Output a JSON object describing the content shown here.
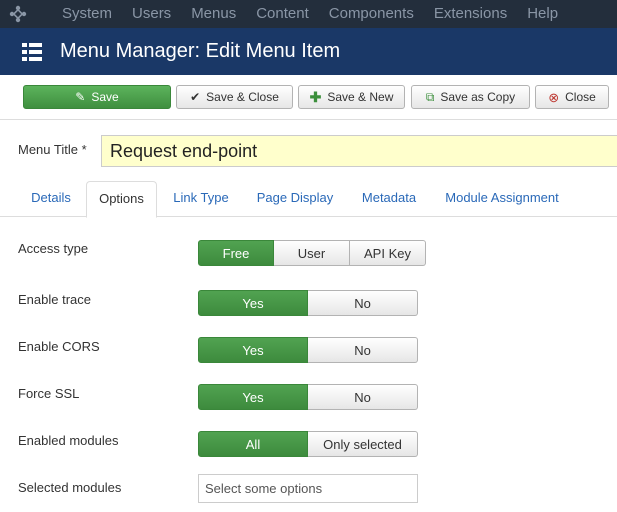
{
  "navbar": {
    "items": [
      "System",
      "Users",
      "Menus",
      "Content",
      "Components",
      "Extensions",
      "Help"
    ]
  },
  "header": {
    "title": "Menu Manager: Edit Menu Item"
  },
  "toolbar": {
    "save": "Save",
    "save_close": "Save & Close",
    "save_new": "Save & New",
    "save_copy": "Save as Copy",
    "close": "Close"
  },
  "menu_title": {
    "label": "Menu Title *",
    "value": "Request end-point"
  },
  "tabs": [
    "Details",
    "Options",
    "Link Type",
    "Page Display",
    "Metadata",
    "Module Assignment"
  ],
  "active_tab": "Options",
  "form": {
    "access_type": {
      "label": "Access type",
      "options": [
        "Free",
        "User",
        "API Key"
      ],
      "selected": "Free"
    },
    "enable_trace": {
      "label": "Enable trace",
      "options": [
        "Yes",
        "No"
      ],
      "selected": "Yes"
    },
    "enable_cors": {
      "label": "Enable CORS",
      "options": [
        "Yes",
        "No"
      ],
      "selected": "Yes"
    },
    "force_ssl": {
      "label": "Force SSL",
      "options": [
        "Yes",
        "No"
      ],
      "selected": "Yes"
    },
    "enabled_modules": {
      "label": "Enabled modules",
      "options": [
        "All",
        "Only selected"
      ],
      "selected": "All"
    },
    "selected_modules": {
      "label": "Selected modules",
      "placeholder": "Select some options"
    }
  },
  "colors": {
    "navbar": "#232e3c",
    "header": "#1a3867",
    "success": "#449d44",
    "link": "#2a69b8"
  }
}
